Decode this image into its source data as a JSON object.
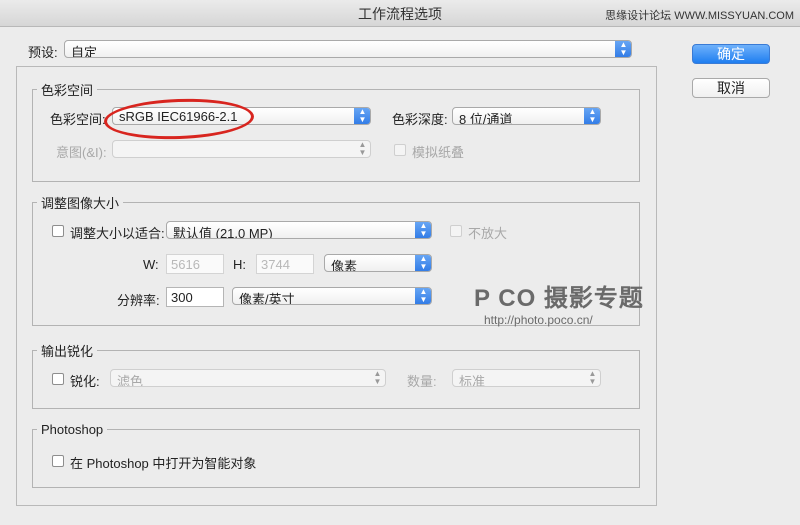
{
  "window": {
    "title": "工作流程选项",
    "watermark_top": "思缘设计论坛 WWW.MISSYUAN.COM"
  },
  "preset": {
    "label": "预设:",
    "value": "自定"
  },
  "buttons": {
    "ok": "确定",
    "cancel": "取消"
  },
  "color_space": {
    "legend": "色彩空间",
    "space_label": "色彩空间:",
    "space_value": "sRGB IEC61966-2.1",
    "depth_label": "色彩深度:",
    "depth_value": "8 位/通道",
    "intent_label": "意图(&I):",
    "intent_value": "",
    "simulate_paper_label": "模拟纸叠"
  },
  "resize": {
    "legend": "调整图像大小",
    "fit_label": "调整大小以适合:",
    "fit_value": "默认值 (21.0 MP)",
    "dont_enlarge_label": "不放大",
    "w_label": "W:",
    "w_value": "5616",
    "h_label": "H:",
    "h_value": "3744",
    "unit_value": "像素",
    "resolution_label": "分辨率:",
    "resolution_value": "300",
    "resolution_unit_value": "像素/英寸"
  },
  "sharpen": {
    "legend": "输出锐化",
    "sharpen_label": "锐化:",
    "sharpen_value": "滤色",
    "amount_label": "数量:",
    "amount_value": "标准"
  },
  "photoshop": {
    "legend": "Photoshop",
    "smart_object_label": "在 Photoshop 中打开为智能对象"
  },
  "watermark": {
    "logo_text": "P  CO 摄影专题",
    "url": "http://photo.poco.cn/"
  },
  "colors": {
    "accent": "#2f7ae6",
    "highlight_ellipse": "#d8251f"
  }
}
